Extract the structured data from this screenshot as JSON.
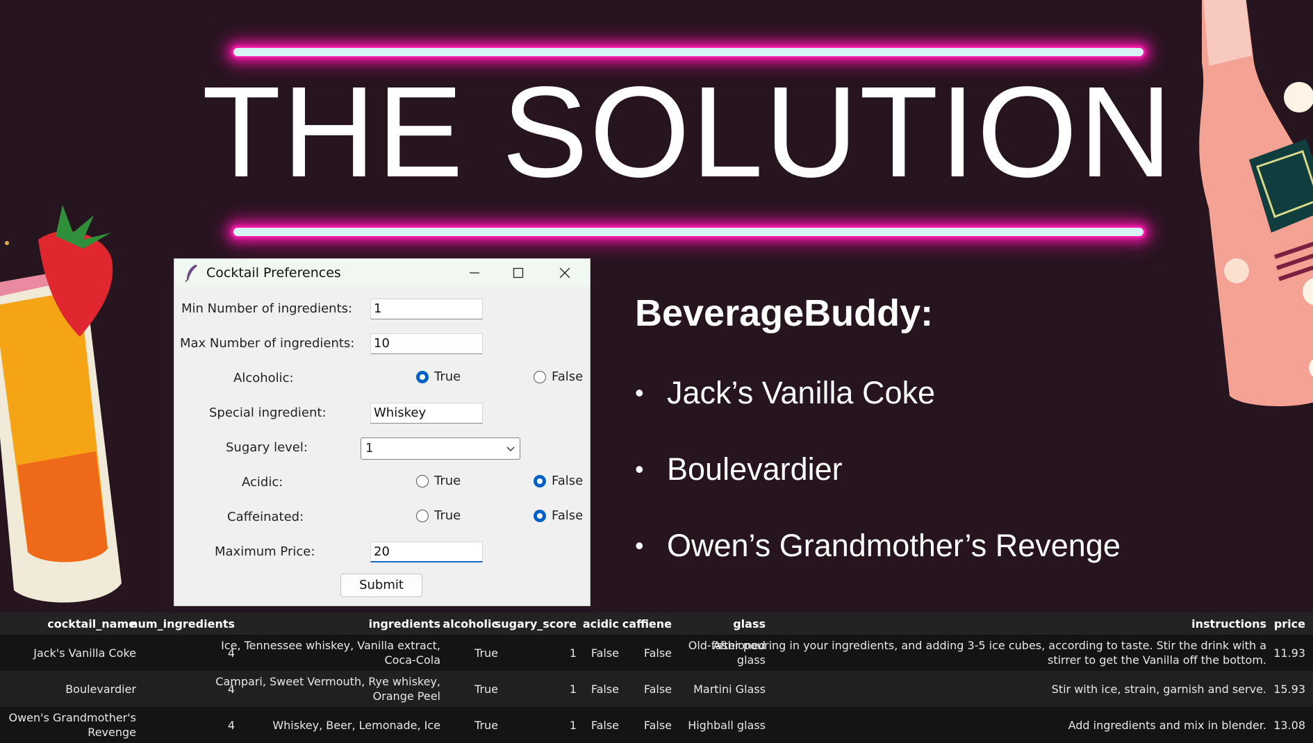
{
  "slide": {
    "title": "THE SOLUTION",
    "colors": {
      "background": "#26141f",
      "neon": "#ff1fae",
      "accent_radio": "#0060c8"
    }
  },
  "window": {
    "title": "Cocktail Preferences",
    "icon": "feather-icon",
    "controls": [
      "minimize-icon",
      "maximize-icon",
      "close-icon"
    ],
    "fields": {
      "min_ingredients": {
        "label": "Min Number of ingredients:",
        "value": "1"
      },
      "max_ingredients": {
        "label": "Max Number of ingredients:",
        "value": "10"
      },
      "alcoholic": {
        "label": "Alcoholic:",
        "true_label": "True",
        "false_label": "False",
        "selected": "True"
      },
      "special_ingredient": {
        "label": "Special ingredient:",
        "value": "Whiskey"
      },
      "sugary_level": {
        "label": "Sugary level:",
        "value": "1"
      },
      "acidic": {
        "label": "Acidic:",
        "true_label": "True",
        "false_label": "False",
        "selected": "False"
      },
      "caffeinated": {
        "label": "Caffeinated:",
        "true_label": "True",
        "false_label": "False",
        "selected": "False"
      },
      "max_price": {
        "label": "Maximum Price:",
        "value": "20"
      }
    },
    "submit_label": "Submit"
  },
  "results": {
    "heading": "BeverageBuddy:",
    "bullet": "•",
    "items": [
      "Jack’s Vanilla Coke",
      "Boulevardier",
      "Owen’s Grandmother’s Revenge"
    ]
  },
  "table": {
    "headers": [
      "cocktail_name",
      "num_ingredients",
      "ingredients",
      "alcoholic",
      "sugary_score",
      "acidic",
      "caffiene",
      "glass",
      "instructions",
      "price"
    ],
    "rows": [
      {
        "cocktail_name": [
          "Jack's Vanilla Coke"
        ],
        "num_ingredients": "4",
        "ingredients": [
          "Ice, Tennessee whiskey, Vanilla extract,",
          "Coca-Cola"
        ],
        "alcoholic": "True",
        "sugary_score": "1",
        "acidic": "False",
        "caffiene": "False",
        "glass": [
          "Old-fashioned",
          "glass"
        ],
        "instructions": [
          "After pouring in your ingredients, and adding 3-5 ice cubes, according to taste. Stir the drink with a",
          "stirrer to get the Vanilla off the bottom."
        ],
        "price": "11.93"
      },
      {
        "cocktail_name": [
          "Boulevardier"
        ],
        "num_ingredients": "4",
        "ingredients": [
          "Campari, Sweet Vermouth, Rye whiskey,",
          "Orange Peel"
        ],
        "alcoholic": "True",
        "sugary_score": "1",
        "acidic": "False",
        "caffiene": "False",
        "glass": [
          "Martini Glass"
        ],
        "instructions": [
          "Stir with ice, strain, garnish and serve."
        ],
        "price": "15.93"
      },
      {
        "cocktail_name": [
          "Owen's Grandmother's",
          "Revenge"
        ],
        "num_ingredients": "4",
        "ingredients": [
          "Whiskey, Beer, Lemonade, Ice"
        ],
        "alcoholic": "True",
        "sugary_score": "1",
        "acidic": "False",
        "caffiene": "False",
        "glass": [
          "Highball glass"
        ],
        "instructions": [
          "Add ingredients and mix in blender."
        ],
        "price": "13.08"
      }
    ]
  }
}
